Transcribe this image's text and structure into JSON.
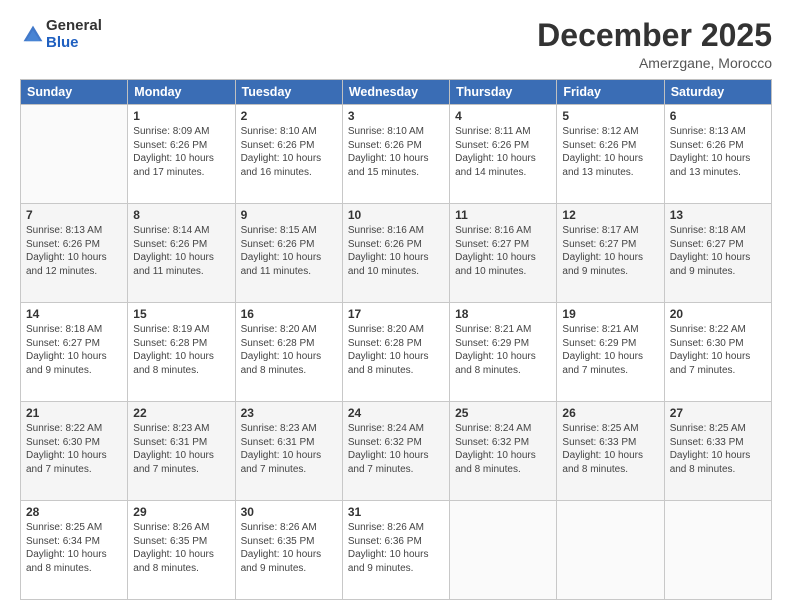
{
  "logo": {
    "general": "General",
    "blue": "Blue"
  },
  "header": {
    "month_year": "December 2025",
    "location": "Amerzgane, Morocco"
  },
  "days_of_week": [
    "Sunday",
    "Monday",
    "Tuesday",
    "Wednesday",
    "Thursday",
    "Friday",
    "Saturday"
  ],
  "weeks": [
    [
      {
        "day": "",
        "info": ""
      },
      {
        "day": "1",
        "info": "Sunrise: 8:09 AM\nSunset: 6:26 PM\nDaylight: 10 hours\nand 17 minutes."
      },
      {
        "day": "2",
        "info": "Sunrise: 8:10 AM\nSunset: 6:26 PM\nDaylight: 10 hours\nand 16 minutes."
      },
      {
        "day": "3",
        "info": "Sunrise: 8:10 AM\nSunset: 6:26 PM\nDaylight: 10 hours\nand 15 minutes."
      },
      {
        "day": "4",
        "info": "Sunrise: 8:11 AM\nSunset: 6:26 PM\nDaylight: 10 hours\nand 14 minutes."
      },
      {
        "day": "5",
        "info": "Sunrise: 8:12 AM\nSunset: 6:26 PM\nDaylight: 10 hours\nand 13 minutes."
      },
      {
        "day": "6",
        "info": "Sunrise: 8:13 AM\nSunset: 6:26 PM\nDaylight: 10 hours\nand 13 minutes."
      }
    ],
    [
      {
        "day": "7",
        "info": "Sunrise: 8:13 AM\nSunset: 6:26 PM\nDaylight: 10 hours\nand 12 minutes."
      },
      {
        "day": "8",
        "info": "Sunrise: 8:14 AM\nSunset: 6:26 PM\nDaylight: 10 hours\nand 11 minutes."
      },
      {
        "day": "9",
        "info": "Sunrise: 8:15 AM\nSunset: 6:26 PM\nDaylight: 10 hours\nand 11 minutes."
      },
      {
        "day": "10",
        "info": "Sunrise: 8:16 AM\nSunset: 6:26 PM\nDaylight: 10 hours\nand 10 minutes."
      },
      {
        "day": "11",
        "info": "Sunrise: 8:16 AM\nSunset: 6:27 PM\nDaylight: 10 hours\nand 10 minutes."
      },
      {
        "day": "12",
        "info": "Sunrise: 8:17 AM\nSunset: 6:27 PM\nDaylight: 10 hours\nand 9 minutes."
      },
      {
        "day": "13",
        "info": "Sunrise: 8:18 AM\nSunset: 6:27 PM\nDaylight: 10 hours\nand 9 minutes."
      }
    ],
    [
      {
        "day": "14",
        "info": "Sunrise: 8:18 AM\nSunset: 6:27 PM\nDaylight: 10 hours\nand 9 minutes."
      },
      {
        "day": "15",
        "info": "Sunrise: 8:19 AM\nSunset: 6:28 PM\nDaylight: 10 hours\nand 8 minutes."
      },
      {
        "day": "16",
        "info": "Sunrise: 8:20 AM\nSunset: 6:28 PM\nDaylight: 10 hours\nand 8 minutes."
      },
      {
        "day": "17",
        "info": "Sunrise: 8:20 AM\nSunset: 6:28 PM\nDaylight: 10 hours\nand 8 minutes."
      },
      {
        "day": "18",
        "info": "Sunrise: 8:21 AM\nSunset: 6:29 PM\nDaylight: 10 hours\nand 8 minutes."
      },
      {
        "day": "19",
        "info": "Sunrise: 8:21 AM\nSunset: 6:29 PM\nDaylight: 10 hours\nand 7 minutes."
      },
      {
        "day": "20",
        "info": "Sunrise: 8:22 AM\nSunset: 6:30 PM\nDaylight: 10 hours\nand 7 minutes."
      }
    ],
    [
      {
        "day": "21",
        "info": "Sunrise: 8:22 AM\nSunset: 6:30 PM\nDaylight: 10 hours\nand 7 minutes."
      },
      {
        "day": "22",
        "info": "Sunrise: 8:23 AM\nSunset: 6:31 PM\nDaylight: 10 hours\nand 7 minutes."
      },
      {
        "day": "23",
        "info": "Sunrise: 8:23 AM\nSunset: 6:31 PM\nDaylight: 10 hours\nand 7 minutes."
      },
      {
        "day": "24",
        "info": "Sunrise: 8:24 AM\nSunset: 6:32 PM\nDaylight: 10 hours\nand 7 minutes."
      },
      {
        "day": "25",
        "info": "Sunrise: 8:24 AM\nSunset: 6:32 PM\nDaylight: 10 hours\nand 8 minutes."
      },
      {
        "day": "26",
        "info": "Sunrise: 8:25 AM\nSunset: 6:33 PM\nDaylight: 10 hours\nand 8 minutes."
      },
      {
        "day": "27",
        "info": "Sunrise: 8:25 AM\nSunset: 6:33 PM\nDaylight: 10 hours\nand 8 minutes."
      }
    ],
    [
      {
        "day": "28",
        "info": "Sunrise: 8:25 AM\nSunset: 6:34 PM\nDaylight: 10 hours\nand 8 minutes."
      },
      {
        "day": "29",
        "info": "Sunrise: 8:26 AM\nSunset: 6:35 PM\nDaylight: 10 hours\nand 8 minutes."
      },
      {
        "day": "30",
        "info": "Sunrise: 8:26 AM\nSunset: 6:35 PM\nDaylight: 10 hours\nand 9 minutes."
      },
      {
        "day": "31",
        "info": "Sunrise: 8:26 AM\nSunset: 6:36 PM\nDaylight: 10 hours\nand 9 minutes."
      },
      {
        "day": "",
        "info": ""
      },
      {
        "day": "",
        "info": ""
      },
      {
        "day": "",
        "info": ""
      }
    ]
  ]
}
